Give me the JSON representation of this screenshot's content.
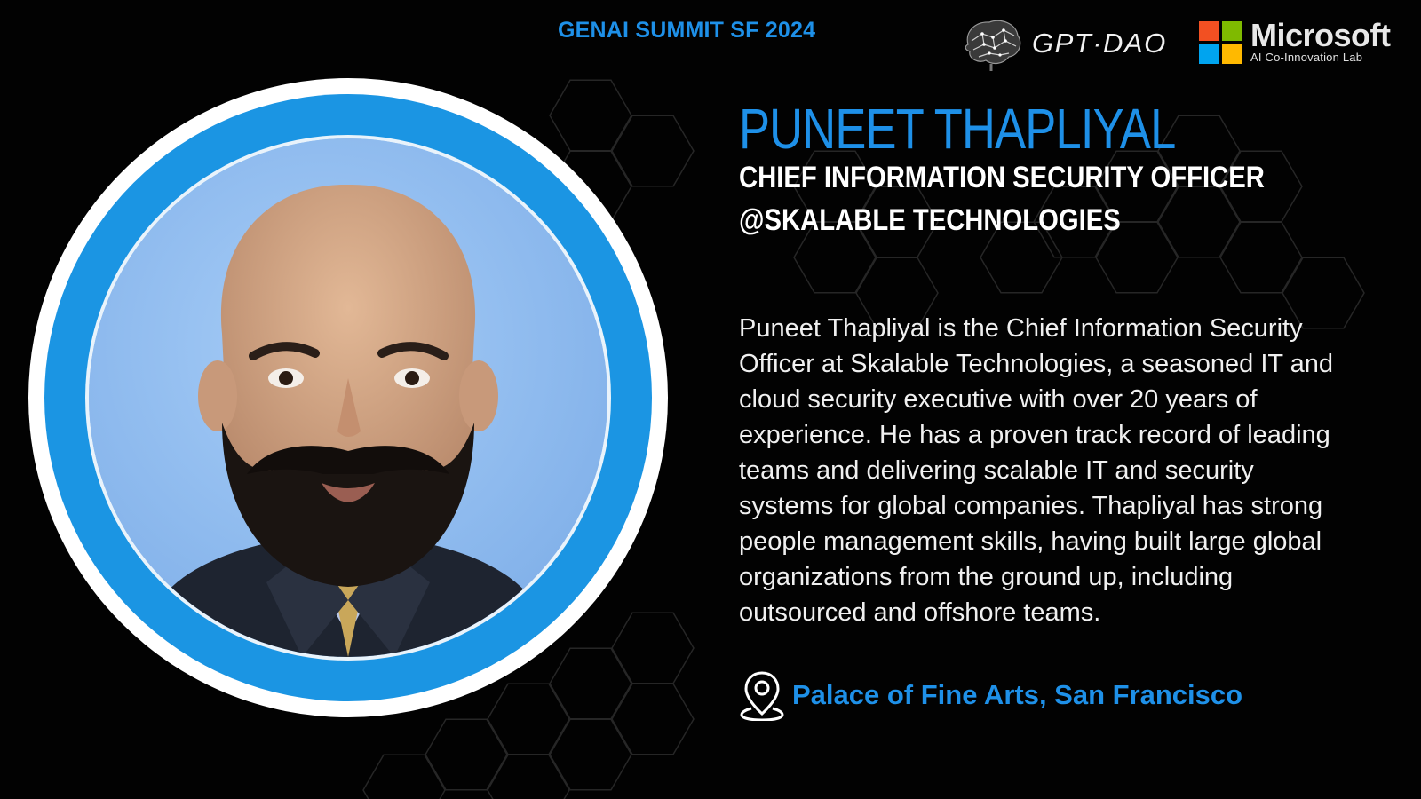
{
  "event": {
    "title": "GENAI SUMMIT SF 2024"
  },
  "logos": {
    "gptdao": {
      "text": "GPT·DAO",
      "icon": "brain-icon"
    },
    "microsoft": {
      "name": "Microsoft",
      "subtitle": "AI Co-Innovation Lab",
      "icon": "microsoft-grid-icon",
      "colors": [
        "#f25022",
        "#7fba00",
        "#00a4ef",
        "#ffb900"
      ]
    }
  },
  "speaker": {
    "name": "PUNEET THAPLIYAL",
    "title_line1": "CHIEF INFORMATION SECURITY OFFICER",
    "title_line2": "@SKALABLE TECHNOLOGIES",
    "bio": "Puneet Thapliyal is the Chief Information Security Officer at Skalable Technologies, a seasoned IT and cloud security executive with over 20 years of experience. He has a proven track record of leading teams and delivering scalable IT and security systems for global companies. Thapliyal has strong people management skills, having built large global organizations from the ground up, including outsourced and offshore teams."
  },
  "location": {
    "text": "Palace of Fine Arts, San Francisco",
    "icon": "location-pin-icon"
  },
  "colors": {
    "accent": "#1e90e8",
    "background": "#020202",
    "ring": "#1b95e3"
  }
}
